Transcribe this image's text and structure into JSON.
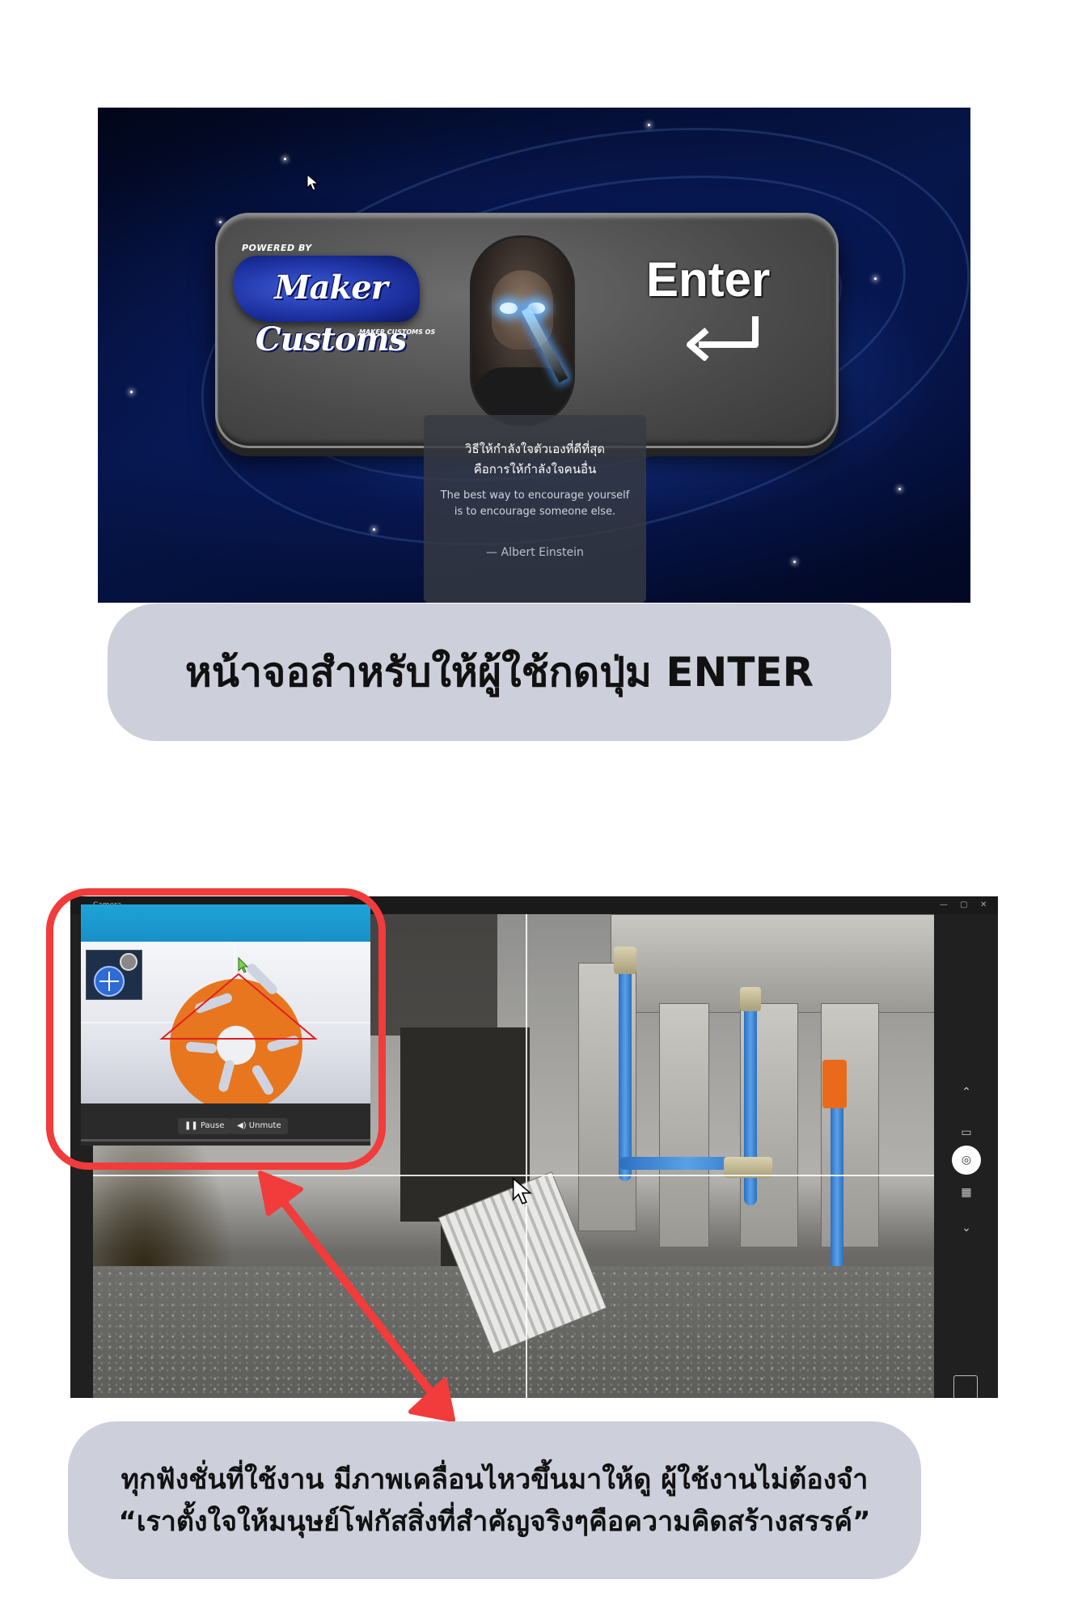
{
  "enter_screen": {
    "powered_by": "POWERED BY",
    "logo_text": "Maker Customs",
    "logo_subtext": "MAKER CUSTOMS OS",
    "key_label": "Enter",
    "quote_thai_line1": "วิธีให้กำลังใจตัวเองที่ดีที่สุด",
    "quote_thai_line2": "คือการให้กำลังใจคนอื่น",
    "quote_en_line1": "The best way to encourage yourself",
    "quote_en_line2": "is to encourage someone else.",
    "quote_author": "— Albert Einstein"
  },
  "caption1": "หน้าจอสำหรับให้ผู้ใช้กดปุ่ม ENTER",
  "camera_app": {
    "window_title": "Camera",
    "window_controls": [
      "—",
      "▢",
      "✕"
    ],
    "pip_pause_label": "Pause",
    "pip_unmute_label": "Unmute",
    "icons": [
      "chevron-up-icon",
      "video-icon",
      "camera-icon",
      "grid-icon",
      "chevron-down-icon"
    ]
  },
  "caption2": {
    "line1": "ทุกฟังชั่นที่ใช้งาน มีภาพเคลื่อนไหวขึ้นมาให้ดู ผู้ใช้งานไม่ต้องจำ",
    "line2": "“เราตั้งใจให้มนุษย์โฟกัสสิ่งที่สำคัญจริงๆคือความคิดสร้างสรรค์”"
  },
  "colors": {
    "highlight": "#f23b3b",
    "caption_bg": "#cdcfdb",
    "pip_bar": "#1fa3d8",
    "part_orange": "#e8761f"
  }
}
